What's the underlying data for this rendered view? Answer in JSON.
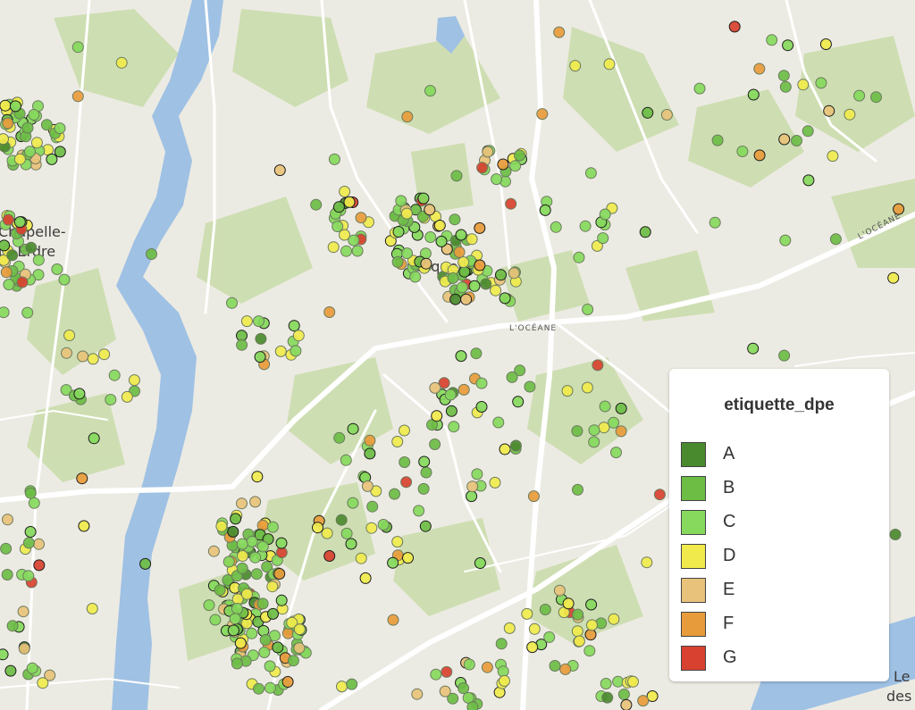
{
  "map": {
    "places": [
      "Chapelle-",
      "ur-Erdre",
      "Carquefou",
      "Le",
      "des"
    ],
    "roads": [
      "L'OCÉANE",
      "L'OCÉANE"
    ]
  },
  "legend": {
    "title": "etiquette_dpe",
    "items": [
      {
        "label": "A",
        "color": "#4a8a2e"
      },
      {
        "label": "B",
        "color": "#6dbd45"
      },
      {
        "label": "C",
        "color": "#86d95c"
      },
      {
        "label": "D",
        "color": "#f0ea4c"
      },
      {
        "label": "E",
        "color": "#e8c27a"
      },
      {
        "label": "F",
        "color": "#e89b3b"
      },
      {
        "label": "G",
        "color": "#d8412f"
      }
    ]
  }
}
